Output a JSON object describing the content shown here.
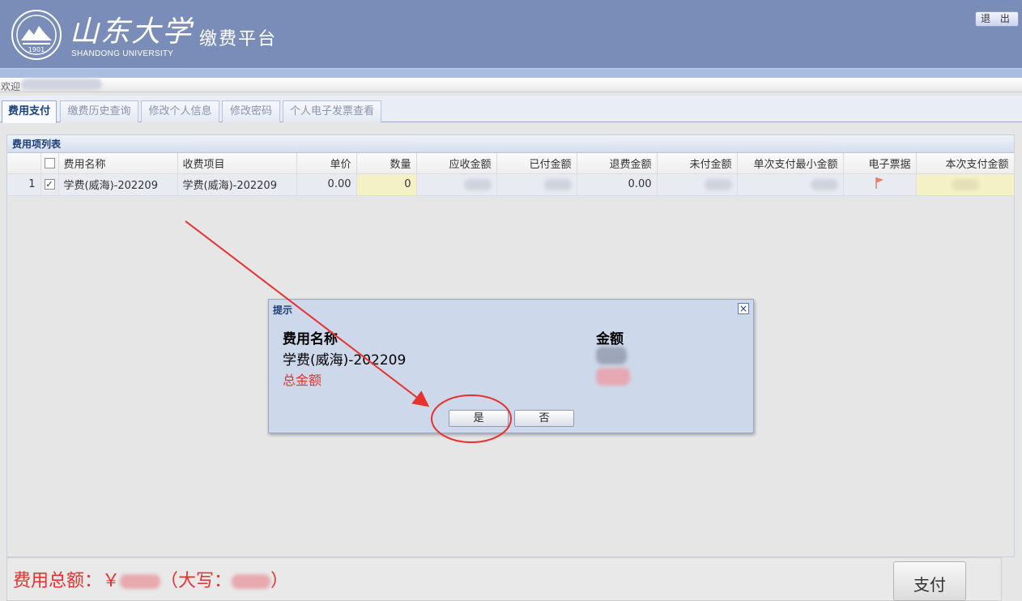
{
  "header": {
    "brand_cn": "山东大学",
    "brand_en": "SHANDONG UNIVERSITY",
    "logo_year": "1901",
    "platform_title": "缴费平台",
    "logout_label": "退 出"
  },
  "welcome": {
    "label": "欢迎"
  },
  "tabs": [
    {
      "label": "费用支付",
      "active": true
    },
    {
      "label": "缴费历史查询"
    },
    {
      "label": "修改个人信息"
    },
    {
      "label": "修改密码"
    },
    {
      "label": "个人电子发票查看"
    }
  ],
  "panel": {
    "title": "费用项列表",
    "columns": [
      "费用名称",
      "收费项目",
      "单价",
      "数量",
      "应收金额",
      "已付金额",
      "退费金额",
      "未付金额",
      "单次支付最小金额",
      "电子票据",
      "本次支付金额"
    ],
    "rows": [
      {
        "index": "1",
        "checked": "✓",
        "fee_name": "学费(威海)-202209",
        "charge_item": "学费(威海)-202209",
        "unit_price": "0.00",
        "quantity": "0",
        "refund": "0.00"
      }
    ]
  },
  "footer": {
    "total_prefix": "费用总额：￥",
    "uppercase_open": "（大写：",
    "uppercase_close": "）",
    "pay_label": "支付"
  },
  "dialog": {
    "title": "提示",
    "close_glyph": "×",
    "col_name": "费用名称",
    "col_amount": "金额",
    "item_name": "学费(威海)-202209",
    "total_label": "总金额",
    "yes_label": "是",
    "no_label": "否"
  },
  "colors": {
    "header_bg": "#7a8db8",
    "accent_red": "#e8302e",
    "tab_active_text": "#1a3f7a",
    "dialog_bg": "#cdd9ea",
    "annotation_red": "#e8302e"
  }
}
